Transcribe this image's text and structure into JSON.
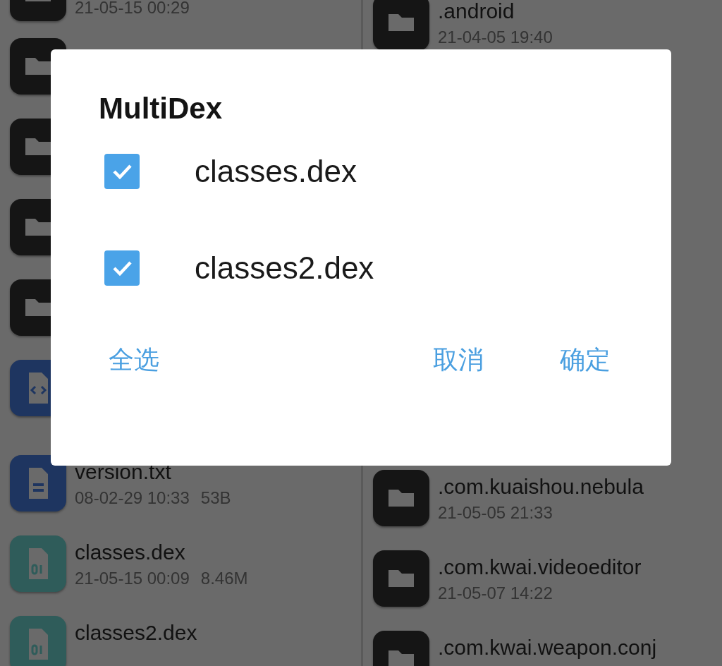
{
  "left_pane": {
    "items": [
      {
        "kind": "folder",
        "date": "21-05-15 00:29"
      },
      {
        "kind": "folder"
      },
      {
        "kind": "folder"
      },
      {
        "kind": "folder"
      },
      {
        "kind": "folder"
      },
      {
        "kind": "code"
      },
      {
        "kind": "text",
        "name": "version.txt",
        "date": "08-02-29 10:33",
        "size": "53B"
      },
      {
        "kind": "dex",
        "name": "classes.dex",
        "date": "21-05-15 00:09",
        "size": "8.46M"
      },
      {
        "kind": "dex",
        "name": "classes2.dex"
      }
    ]
  },
  "right_pane": {
    "top_items": [
      {
        "kind": "folder",
        "name": ".android",
        "date": "21-04-05 19:40"
      }
    ],
    "bottom_items": [
      {
        "kind": "folder",
        "name": ".com.kuaishou.nebula",
        "date": "21-05-05 21:33"
      },
      {
        "kind": "folder",
        "name": ".com.kwai.videoeditor",
        "date": "21-05-07 14:22"
      },
      {
        "kind": "folder",
        "name": ".com.kwai.weapon.conj"
      }
    ]
  },
  "dialog": {
    "title": "MultiDex",
    "options": [
      {
        "label": "classes.dex",
        "checked": true
      },
      {
        "label": "classes2.dex",
        "checked": true
      }
    ],
    "left_buttons": [
      "全选"
    ],
    "right_buttons": [
      "取消",
      "确定"
    ]
  }
}
